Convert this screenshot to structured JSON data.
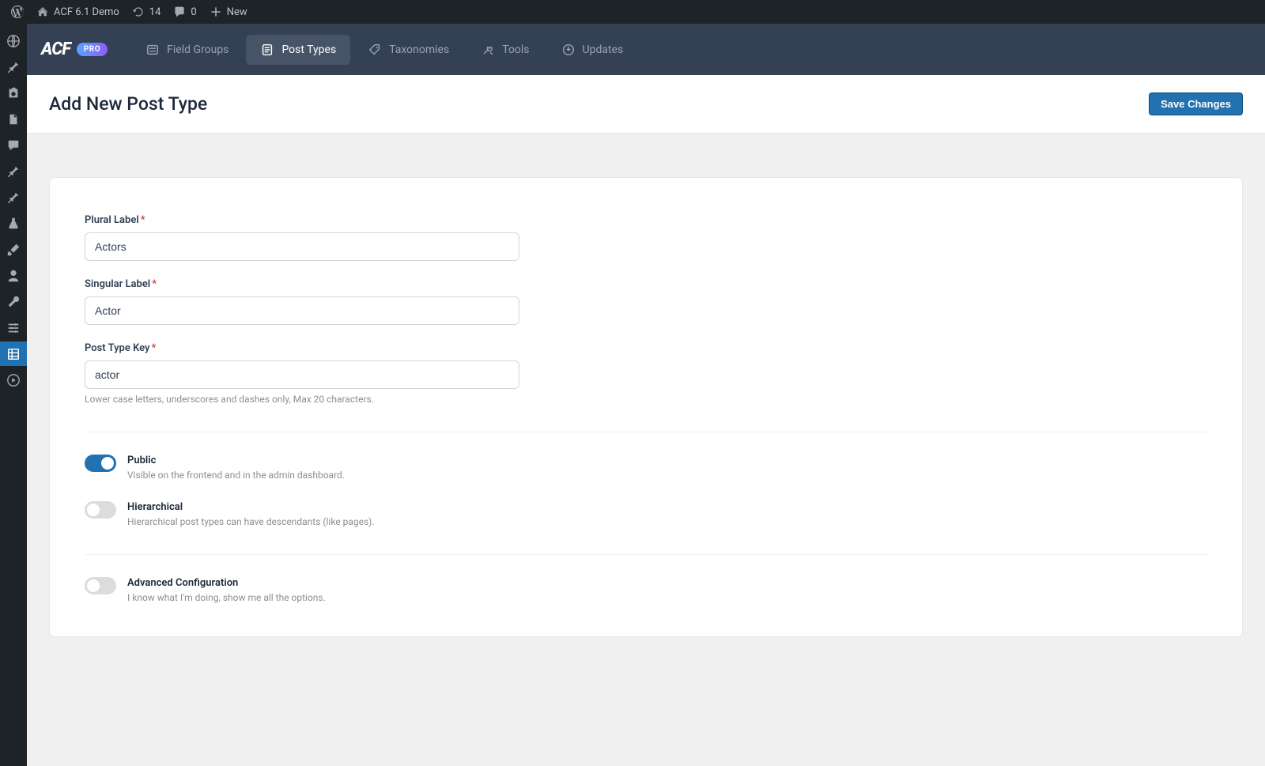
{
  "adminbar": {
    "site_name": "ACF 6.1 Demo",
    "updates_count": "14",
    "comments_count": "0",
    "new_label": "New"
  },
  "sidebar_menu": {
    "items": [
      "dashboard-icon",
      "pin-icon",
      "gear2-icon",
      "book-icon",
      "comment-icon",
      "pin2-icon",
      "pin3-icon",
      "lab-icon",
      "brush-icon",
      "user-icon",
      "wrench-icon",
      "db-icon",
      "grid-icon",
      "play-icon"
    ]
  },
  "acf_header": {
    "logo": "ACF",
    "pro_badge": "PRO",
    "nav": {
      "field_groups": "Field Groups",
      "post_types": "Post Types",
      "taxonomies": "Taxonomies",
      "tools": "Tools",
      "updates": "Updates"
    }
  },
  "page": {
    "title": "Add New Post Type",
    "save_button": "Save Changes"
  },
  "form": {
    "plural": {
      "label": "Plural Label",
      "value": "Actors"
    },
    "singular": {
      "label": "Singular Label",
      "value": "Actor"
    },
    "key": {
      "label": "Post Type Key",
      "value": "actor",
      "help": "Lower case letters, underscores and dashes only, Max 20 characters."
    }
  },
  "toggles": {
    "public": {
      "label": "Public",
      "desc": "Visible on the frontend and in the admin dashboard.",
      "on": true
    },
    "hierarchical": {
      "label": "Hierarchical",
      "desc": "Hierarchical post types can have descendants (like pages).",
      "on": false
    },
    "advanced": {
      "label": "Advanced Configuration",
      "desc": "I know what I'm doing, show me all the options.",
      "on": false
    }
  }
}
